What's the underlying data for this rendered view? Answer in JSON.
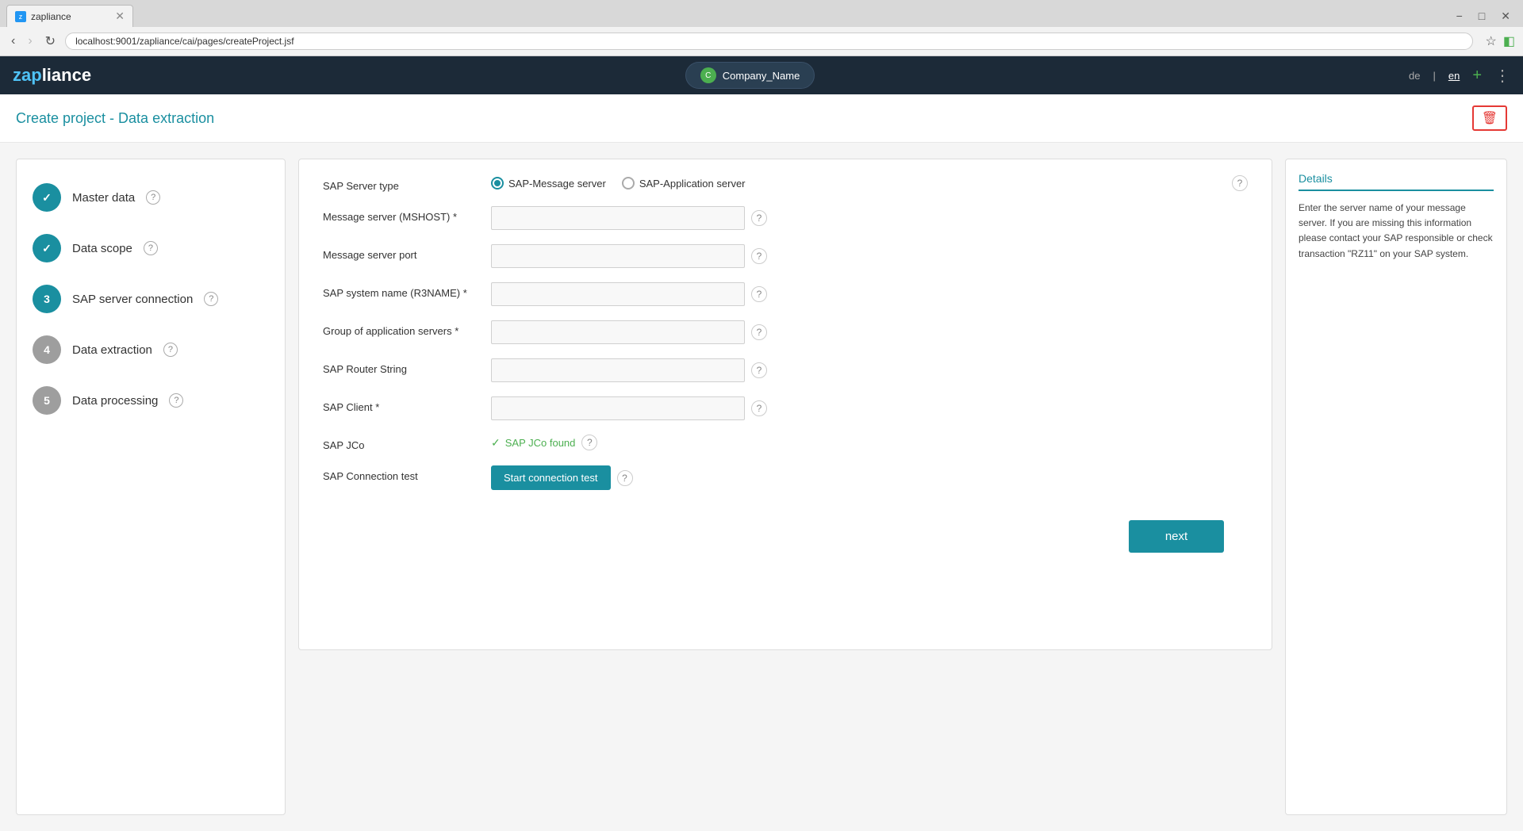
{
  "browser": {
    "tab_title": "zapliance",
    "url": "localhost:9001/zapliance/cai/pages/createProject.jsf",
    "lang_de": "de",
    "lang_en": "en"
  },
  "nav": {
    "logo_zap": "zap",
    "logo_liance": "liance",
    "company_name": "Company_Name",
    "lang_de": "de",
    "lang_en": "en",
    "plus_icon": "+",
    "menu_icon": "⋮"
  },
  "page": {
    "title": "Create project - Data extraction",
    "delete_icon": "🗑"
  },
  "steps": [
    {
      "number": "✓",
      "label": "Master data",
      "state": "completed"
    },
    {
      "number": "✓",
      "label": "Data scope",
      "state": "completed"
    },
    {
      "number": "3",
      "label": "SAP server connection",
      "state": "active"
    },
    {
      "number": "4",
      "label": "Data extraction",
      "state": "inactive"
    },
    {
      "number": "5",
      "label": "Data processing",
      "state": "inactive"
    }
  ],
  "form": {
    "server_type_label": "SAP Server type",
    "radio_message": "SAP-Message server",
    "radio_application": "SAP-Application server",
    "message_server_label": "Message server (MSHOST) *",
    "message_server_placeholder": "",
    "message_port_label": "Message server port",
    "message_port_placeholder": "",
    "sap_system_label": "SAP system name (R3NAME) *",
    "sap_system_placeholder": "",
    "group_label": "Group of application servers *",
    "group_placeholder": "",
    "router_label": "SAP Router String",
    "router_placeholder": "",
    "client_label": "SAP Client *",
    "client_placeholder": "",
    "jco_label": "SAP JCo",
    "jco_status": "SAP JCo found",
    "connection_test_label": "SAP Connection test",
    "connection_test_btn": "Start connection test",
    "next_btn": "next"
  },
  "details": {
    "title": "Details",
    "text": "Enter the server name of your message server. If you are missing this information please contact your SAP responsible or check transaction \"RZ11\" on your SAP system."
  }
}
